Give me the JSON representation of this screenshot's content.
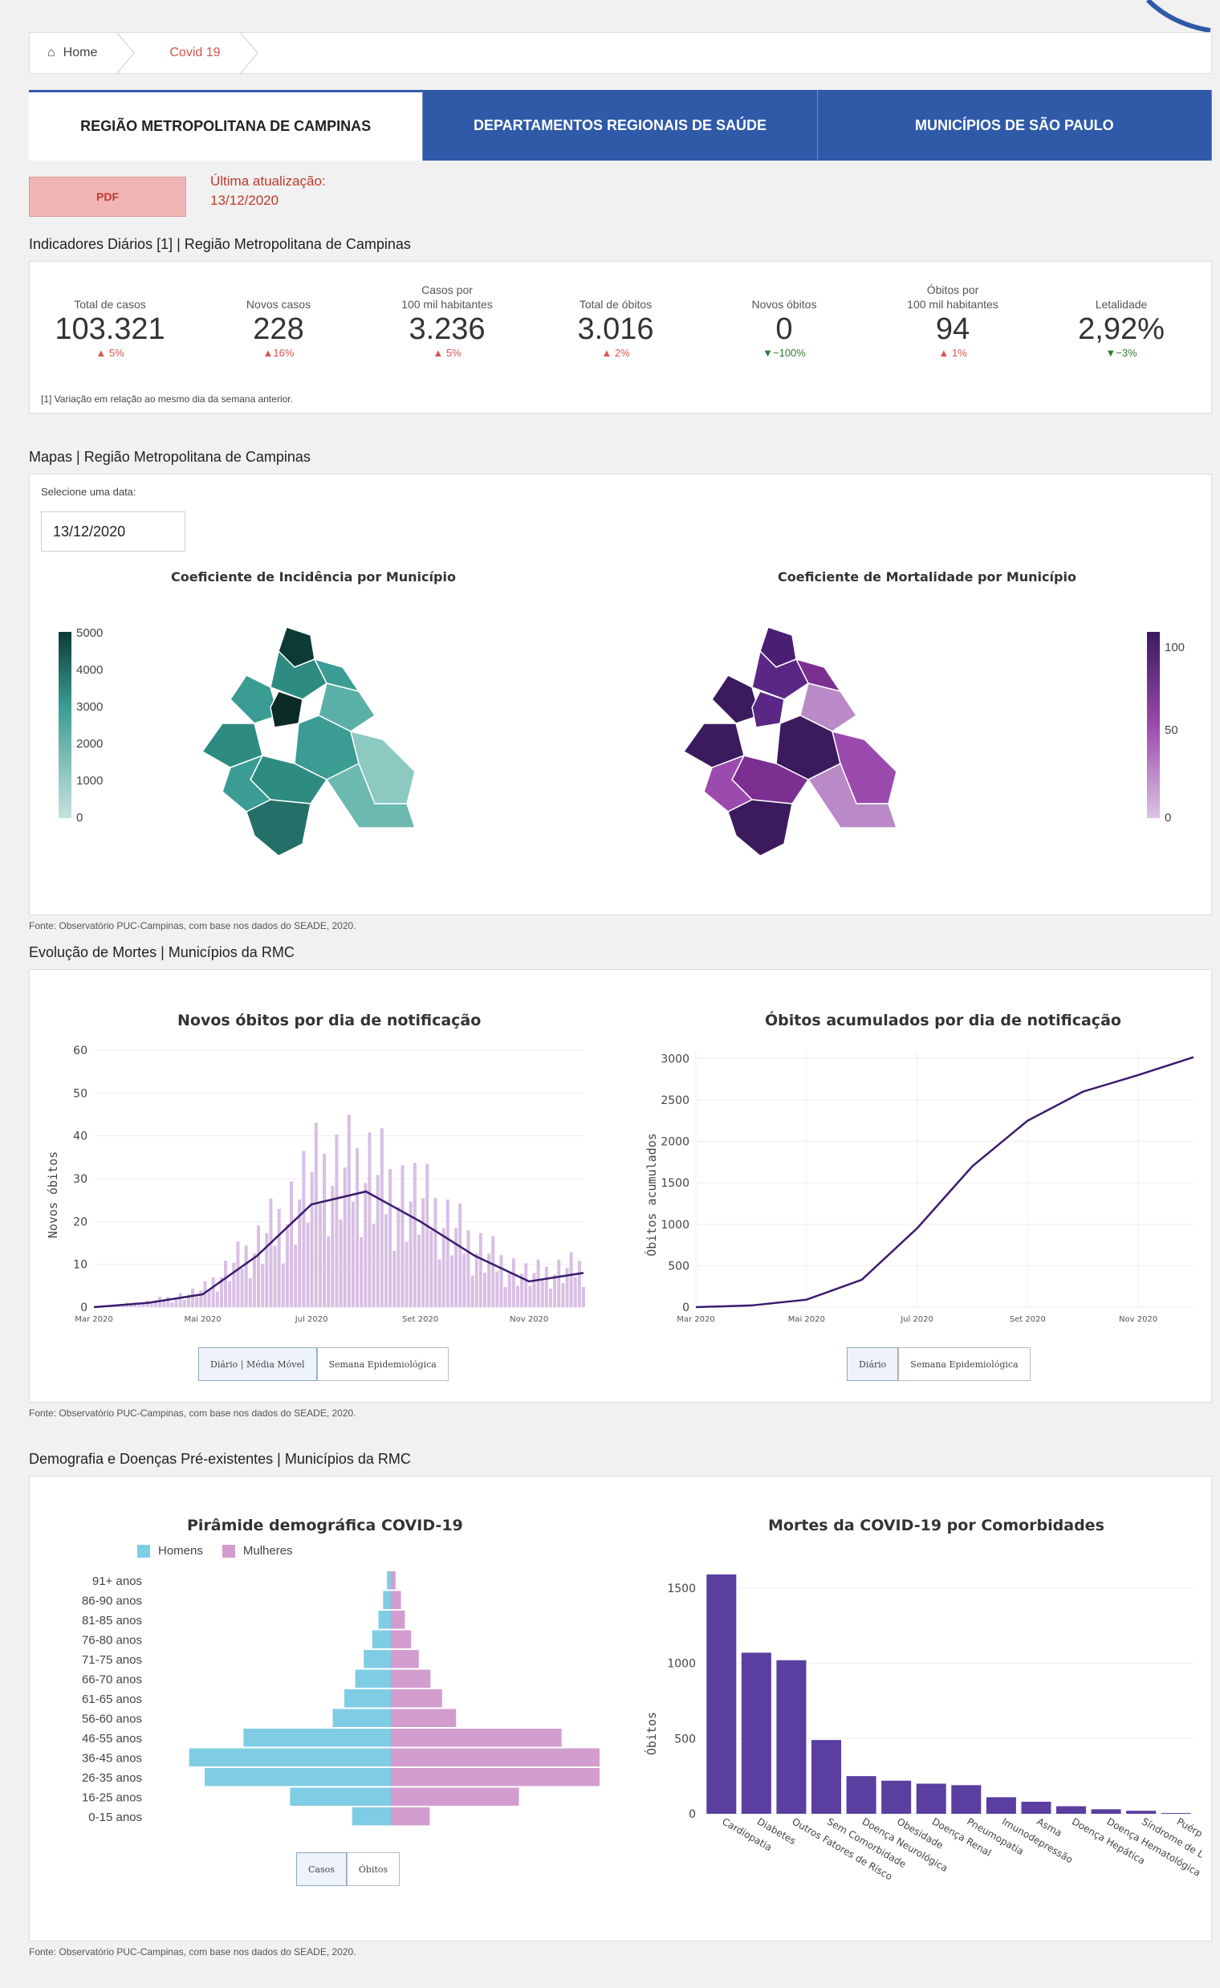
{
  "breadcrumb": {
    "home": "Home",
    "current": "Covid 19"
  },
  "tabs": [
    {
      "label": "REGIÃO METROPOLITANA DE CAMPINAS",
      "active": true
    },
    {
      "label": "DEPARTAMENTOS REGIONAIS DE SAÚDE",
      "active": false
    },
    {
      "label": "MUNICÍPIOS DE SÃO PAULO",
      "active": false
    }
  ],
  "pdf_label": "PDF",
  "update": {
    "label": "Última atualização:",
    "date": "13/12/2020"
  },
  "indicators": {
    "title": "Indicadores Diários [1] | Região Metropolitana de Campinas",
    "items": [
      {
        "label1": "",
        "label2": "Total de casos",
        "value": "103.321",
        "delta": "▲ 5%",
        "dir": "up"
      },
      {
        "label1": "",
        "label2": "Novos casos",
        "value": "228",
        "delta": "▲16%",
        "dir": "up"
      },
      {
        "label1": "Casos por",
        "label2": "100 mil habitantes",
        "value": "3.236",
        "delta": "▲ 5%",
        "dir": "up"
      },
      {
        "label1": "",
        "label2": "Total de óbitos",
        "value": "3.016",
        "delta": "▲ 2%",
        "dir": "up"
      },
      {
        "label1": "",
        "label2": "Novos óbitos",
        "value": "0",
        "delta": "▼−100%",
        "dir": "down"
      },
      {
        "label1": "Óbitos por",
        "label2": "100 mil habitantes",
        "value": "94",
        "delta": "▲ 1%",
        "dir": "up"
      },
      {
        "label1": "",
        "label2": "Letalidade",
        "value": "2,92%",
        "delta": "▼−3%",
        "dir": "down"
      }
    ],
    "note": "[1] Variação em relação ao mesmo dia da semana anterior."
  },
  "maps": {
    "title": "Mapas | Região Metropolitana de Campinas",
    "date_label": "Selecione uma data:",
    "date_value": "13/12/2020",
    "incidence": {
      "title": "Coeficiente de Incidência por Município",
      "scale": [
        "5000",
        "4000",
        "3000",
        "2000",
        "1000",
        "0"
      ]
    },
    "mortality": {
      "title": "Coeficiente de Mortalidade por Município",
      "scale": [
        "100",
        "50",
        "0"
      ]
    },
    "colors": {
      "teal_dark": "#0c3b36",
      "teal": "#3a9c93",
      "teal_light": "#c8e3de",
      "purple_dark": "#3b1a5e",
      "purple": "#7b2f91",
      "purple_light": "#dcc3e3"
    }
  },
  "fonte": "Fonte: Observatório PUC-Campinas, com base nos dados do SEADE, 2020.",
  "deaths": {
    "title": "Evolução de Mortes | Municípios da RMC",
    "daily": {
      "title": "Novos óbitos por dia de notificação",
      "ylabel": "Novos óbitos",
      "yticks": [
        "0",
        "10",
        "20",
        "30",
        "40",
        "50",
        "60"
      ],
      "xticks": [
        "Mar 2020",
        "Mai 2020",
        "Jul 2020",
        "Set 2020",
        "Nov 2020"
      ],
      "buttons": [
        "Diário | Média Móvel",
        "Semana Epidemiológica"
      ]
    },
    "cumulative": {
      "title": "Óbitos acumulados por dia de notificação",
      "ylabel": "Óbitos acumulados",
      "yticks": [
        "0",
        "500",
        "1000",
        "1500",
        "2000",
        "2500",
        "3000"
      ],
      "xticks": [
        "Mar 2020",
        "Mai 2020",
        "Jul 2020",
        "Set 2020",
        "Nov 2020"
      ],
      "buttons": [
        "Diário",
        "Semana Epidemiológica"
      ]
    }
  },
  "demography": {
    "title": "Demografia e Doenças Pré-existentes | Municípios da RMC",
    "pyramid": {
      "title": "Pirâmide demográfica COVID-19",
      "legend": [
        "Homens",
        "Mulheres"
      ],
      "buttons": [
        "Casos",
        "Óbitos"
      ]
    },
    "comorb": {
      "title": "Mortes da COVID-19 por Comorbidades",
      "ylabel": "Óbitos",
      "yticks": [
        "0",
        "500",
        "1000",
        "1500"
      ]
    }
  },
  "chart_data": [
    {
      "type": "line",
      "title": "Novos óbitos por dia de notificação",
      "ylabel": "Novos óbitos",
      "ylim": [
        0,
        60
      ],
      "series": [
        {
          "name": "",
          "x": [
            "Mar 2020",
            "Abr 2020",
            "Mai 2020",
            "Jun 2020",
            "Jul 2020",
            "Ago 2020",
            "Set 2020",
            "Out 2020",
            "Nov 2020",
            "Dez 2020"
          ],
          "values": [
            0,
            1,
            3,
            12,
            24,
            27,
            20,
            12,
            6,
            8
          ]
        }
      ]
    },
    {
      "type": "line",
      "title": "Óbitos acumulados por dia de notificação",
      "ylabel": "Óbitos acumulados",
      "ylim": [
        0,
        3100
      ],
      "series": [
        {
          "name": "",
          "x": [
            "Mar 2020",
            "Abr 2020",
            "Mai 2020",
            "Jun 2020",
            "Jul 2020",
            "Ago 2020",
            "Set 2020",
            "Out 2020",
            "Nov 2020",
            "Dez 2020"
          ],
          "values": [
            0,
            20,
            90,
            330,
            950,
            1700,
            2250,
            2600,
            2800,
            3016
          ]
        }
      ]
    },
    {
      "type": "bar",
      "title": "Pirâmide demográfica COVID-19",
      "categories": [
        "91+ anos",
        "86-90 anos",
        "81-85 anos",
        "76-80 anos",
        "71-75 anos",
        "66-70 anos",
        "61-65 anos",
        "56-60 anos",
        "46-55 anos",
        "36-45 anos",
        "26-35 anos",
        "16-25 anos",
        "0-15 anos"
      ],
      "series": [
        {
          "name": "Homens",
          "values": [
            500,
            1000,
            1600,
            2400,
            3500,
            4600,
            6000,
            7500,
            19000,
            26000,
            24000,
            13000,
            5000
          ]
        },
        {
          "name": "Mulheres",
          "values": [
            600,
            1300,
            1800,
            2600,
            3600,
            5100,
            6600,
            8400,
            22000,
            30000,
            28000,
            16500,
            5000
          ]
        }
      ]
    },
    {
      "type": "bar",
      "title": "Mortes da COVID-19 por Comorbidades",
      "ylabel": "Óbitos",
      "ylim": [
        0,
        1600
      ],
      "categories": [
        "Cardiopatia",
        "Diabetes",
        "Outros Fatores de Risco",
        "Sem Comorbidade",
        "Doença Neurológica",
        "Obesidade",
        "Doença Renal",
        "Pneumopatia",
        "Imunodepressão",
        "Asma",
        "Doença Hepática",
        "Doença Hematológica",
        "Síndrome de Down",
        "Puérpera"
      ],
      "values": [
        1590,
        1070,
        1020,
        490,
        250,
        220,
        200,
        190,
        110,
        80,
        50,
        30,
        20,
        5
      ]
    }
  ]
}
